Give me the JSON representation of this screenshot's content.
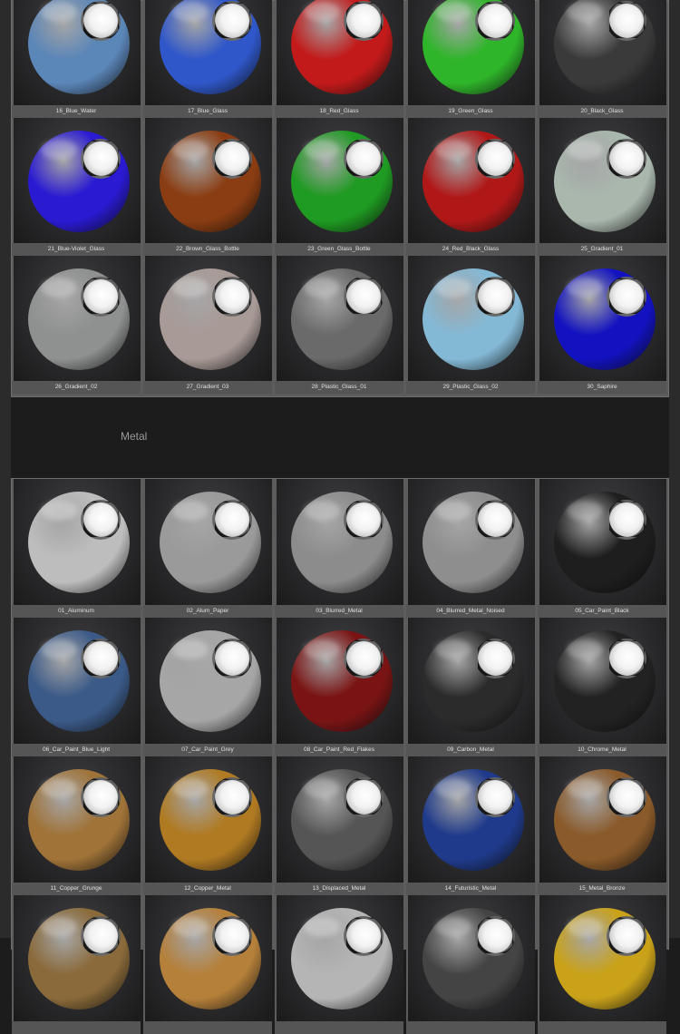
{
  "glass": {
    "items": [
      {
        "label": "16_Blue_Water",
        "color": "#5b86b8"
      },
      {
        "label": "17_Blue_Glass",
        "color": "#2f57c9"
      },
      {
        "label": "18_Red_Glass",
        "color": "#c21a1a"
      },
      {
        "label": "19_Green_Glass",
        "color": "#2fb52a"
      },
      {
        "label": "20_Black_Glass",
        "color": "#3a3a3a"
      },
      {
        "label": "21_Blue-Violet_Glass",
        "color": "#2a1ad2"
      },
      {
        "label": "22_Brown_Glass_Bottle",
        "color": "#8a3d12"
      },
      {
        "label": "23_Green_Glass_Bottle",
        "color": "#1f9a22"
      },
      {
        "label": "24_Red_Black_Glass",
        "color": "#b01818"
      },
      {
        "label": "25_Gradient_01",
        "color": "#a9b7ad"
      },
      {
        "label": "26_Gradient_02",
        "color": "#8f9090"
      },
      {
        "label": "27_Gradient_03",
        "color": "#a89a96"
      },
      {
        "label": "28_Plastic_Glass_01",
        "color": "#6a6a6a"
      },
      {
        "label": "29_Plastic_Glass_02",
        "color": "#84b9d6"
      },
      {
        "label": "30_Saphire",
        "color": "#1212c0"
      }
    ]
  },
  "metal": {
    "title": "Metal",
    "items": [
      {
        "label": "01_Aluminum",
        "color": "#bdbdbd"
      },
      {
        "label": "02_Alum_Paper",
        "color": "#9a9a9a"
      },
      {
        "label": "03_Blurred_Metal",
        "color": "#8c8c8c"
      },
      {
        "label": "04_Blurred_Metal_Noised",
        "color": "#8e8e8e"
      },
      {
        "label": "05_Car_Paint_Black",
        "color": "#1e1e1e"
      },
      {
        "label": "06_Car_Paint_Blue_Light",
        "color": "#3b5a88"
      },
      {
        "label": "07_Car_Paint_Grey",
        "color": "#a6a6a6"
      },
      {
        "label": "08_Car_Paint_Red_Flakes",
        "color": "#7a1414"
      },
      {
        "label": "09_Carbon_Metal",
        "color": "#2b2b2b"
      },
      {
        "label": "10_Chrome_Metal",
        "color": "#222222"
      },
      {
        "label": "11_Copper_Grunge",
        "color": "#a07338"
      },
      {
        "label": "12_Copper_Metal",
        "color": "#b07a22"
      },
      {
        "label": "13_Displaced_Metal",
        "color": "#555555"
      },
      {
        "label": "14_Futuristic_Metal",
        "color": "#1f3a8a"
      },
      {
        "label": "15_Metal_Bronze",
        "color": "#8a5a2a"
      },
      {
        "label": "",
        "color": "#8a6a3a"
      },
      {
        "label": "",
        "color": "#b5803a"
      },
      {
        "label": "",
        "color": "#b5b5b5"
      },
      {
        "label": "",
        "color": "#444444"
      },
      {
        "label": "",
        "color": "#c9a21a"
      }
    ]
  }
}
